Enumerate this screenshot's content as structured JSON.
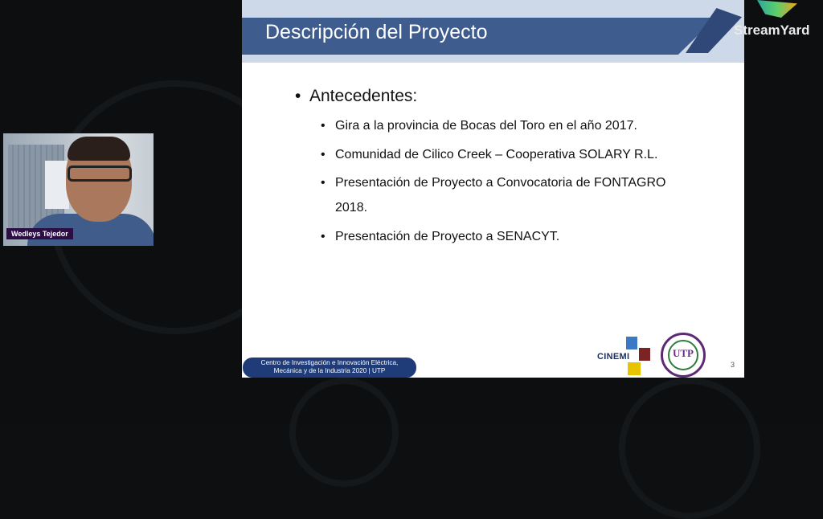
{
  "participant": {
    "name": "Wedleys Tejedor"
  },
  "slide": {
    "title": "Descripción del Proyecto",
    "main_bullet": "Antecedentes:",
    "sub_bullets": [
      {
        "text": "Gira a la provincia de Bocas del Toro en el año 2017."
      },
      {
        "text": "Comunidad de Cilico Creek – Cooperativa SOLARY R.L."
      },
      {
        "text": "Presentación de Proyecto a Convocatoria de FONTAGRO",
        "cont": "2018."
      },
      {
        "text": "Presentación de Proyecto a SENACYT."
      }
    ],
    "footer_line1": "Centro de Investigación e Innovación Eléctrica,",
    "footer_line2": "Mecánica y de la Industria  2020 | UTP",
    "page_number": "3",
    "logo_left": "CINEMI",
    "logo_right": "UTP"
  },
  "brand": {
    "name": "StreamYard"
  },
  "colors": {
    "title_band": "#3f5c8f",
    "footer_pill": "#1f3b78",
    "name_tag": "#2b0f44"
  }
}
